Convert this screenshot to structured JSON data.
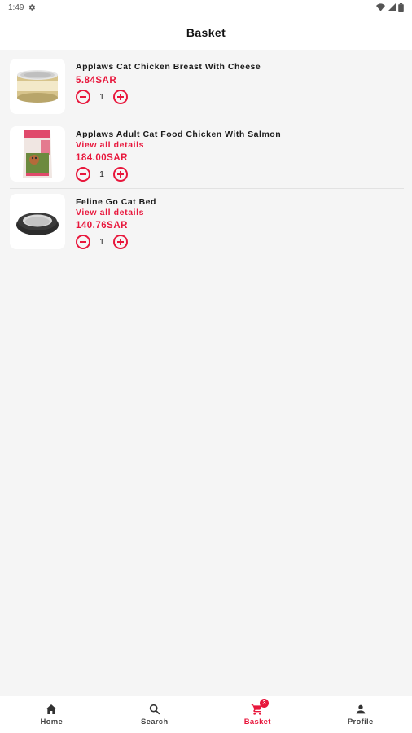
{
  "status_bar": {
    "time": "1:49"
  },
  "header": {
    "title": "Basket"
  },
  "colors": {
    "accent": "#e8173c",
    "background": "#f5f5f5",
    "card": "#ffffff"
  },
  "items": [
    {
      "name": "Applaws Cat Chicken Breast With Cheese",
      "details": "",
      "price": "5.84SAR",
      "qty": "1",
      "image": "cat-food-can-image"
    },
    {
      "name": "Applaws Adult Cat Food Chicken With Salmon",
      "details": "View all details",
      "price": "184.00SAR",
      "qty": "1",
      "image": "cat-food-bag-image"
    },
    {
      "name": "Feline Go Cat Bed",
      "details": "View all details",
      "price": "140.76SAR",
      "qty": "1",
      "image": "cat-bed-image"
    }
  ],
  "bottom_nav": {
    "home": {
      "label": "Home",
      "icon": "home-icon"
    },
    "search": {
      "label": "Search",
      "icon": "search-icon"
    },
    "basket": {
      "label": "Basket",
      "icon": "cart-icon",
      "badge": "3"
    },
    "profile": {
      "label": "Profile",
      "icon": "person-icon"
    }
  }
}
